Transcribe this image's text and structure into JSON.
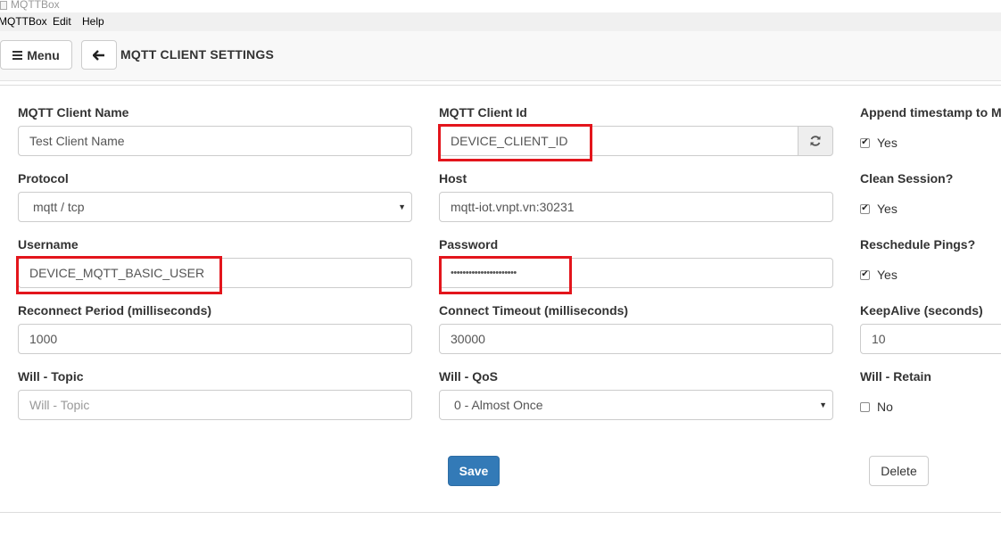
{
  "window": {
    "title": "MQTTBox"
  },
  "menubar": {
    "items": [
      "MQTTBox",
      "Edit",
      "Help"
    ]
  },
  "header": {
    "menu_label": "Menu",
    "page_title": "MQTT CLIENT SETTINGS"
  },
  "form": {
    "client_name": {
      "label": "MQTT Client Name",
      "value": "Test Client Name"
    },
    "client_id": {
      "label": "MQTT Client Id",
      "value": "DEVICE_CLIENT_ID"
    },
    "append_timestamp": {
      "label": "Append timestamp to M",
      "option": "Yes",
      "checked": true
    },
    "protocol": {
      "label": "Protocol",
      "value": "mqtt / tcp"
    },
    "host": {
      "label": "Host",
      "value": "mqtt-iot.vnpt.vn:30231"
    },
    "clean_session": {
      "label": "Clean Session?",
      "option": "Yes",
      "checked": true
    },
    "username": {
      "label": "Username",
      "value": "DEVICE_MQTT_BASIC_USER"
    },
    "password": {
      "label": "Password",
      "value": "••••••••••••••••••••••"
    },
    "reschedule_pings": {
      "label": "Reschedule Pings?",
      "option": "Yes",
      "checked": true
    },
    "reconnect_period": {
      "label": "Reconnect Period (milliseconds)",
      "value": "1000"
    },
    "connect_timeout": {
      "label": "Connect Timeout (milliseconds)",
      "value": "30000"
    },
    "keepalive": {
      "label": "KeepAlive (seconds)",
      "value": "10"
    },
    "will_topic": {
      "label": "Will - Topic",
      "value": "",
      "placeholder": "Will - Topic"
    },
    "will_qos": {
      "label": "Will - QoS",
      "value": "0 - Almost Once"
    },
    "will_retain": {
      "label": "Will - Retain",
      "option": "No",
      "checked": false
    }
  },
  "actions": {
    "save_label": "Save",
    "delete_label": "Delete"
  },
  "colors": {
    "primary": "#337ab7",
    "highlight": "#e3151c"
  }
}
